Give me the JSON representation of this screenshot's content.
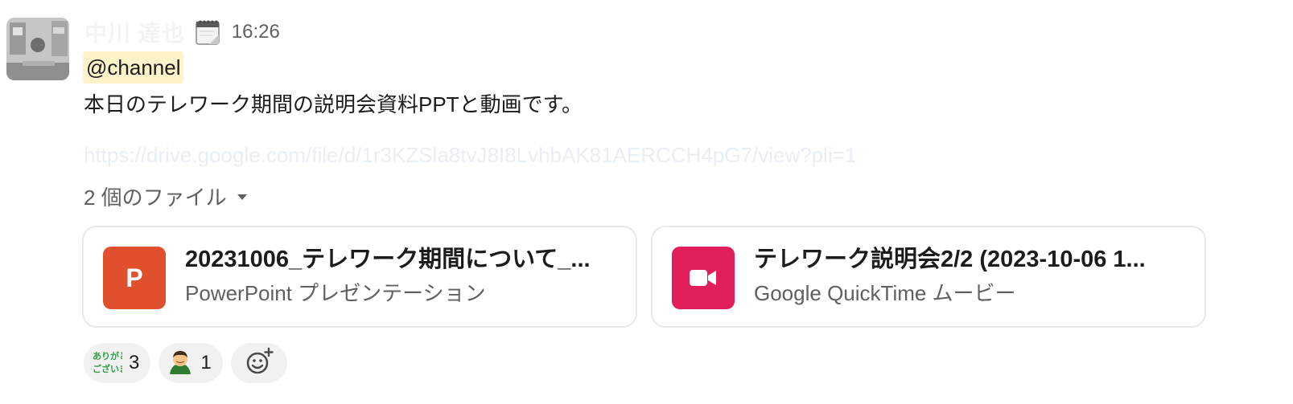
{
  "message": {
    "sender": "中川 達也",
    "time": "16:26",
    "mention": "@channel",
    "text": "本日のテレワーク期間の説明会資料PPTと動画です。",
    "link": "https://drive.google.com/file/d/1r3KZSla8tvJ8I8LvhbAK81AERCCH4pG7/view?pli=1"
  },
  "files": {
    "toggle_label": "2 個のファイル",
    "items": [
      {
        "name": "20231006_テレワーク期間について_...",
        "type": "PowerPoint プレゼンテーション",
        "icon": "powerpoint-icon",
        "color": "#e0502d",
        "glyph": "P"
      },
      {
        "name": "テレワーク説明会2/2 (2023-10-06 1...",
        "type": "Google QuickTime ムービー",
        "icon": "video-icon",
        "color": "#e01e5a"
      }
    ]
  },
  "reactions": [
    {
      "emoji": "arigatou-gozaimasu-emoji",
      "emoji_text": "ありがとうございます",
      "count": "3"
    },
    {
      "emoji": "man-bowing-emoji",
      "count": "1"
    }
  ],
  "icons": {
    "calendar": "calendar-icon",
    "caret": "caret-down-icon",
    "add_reaction": "add-reaction-icon"
  }
}
